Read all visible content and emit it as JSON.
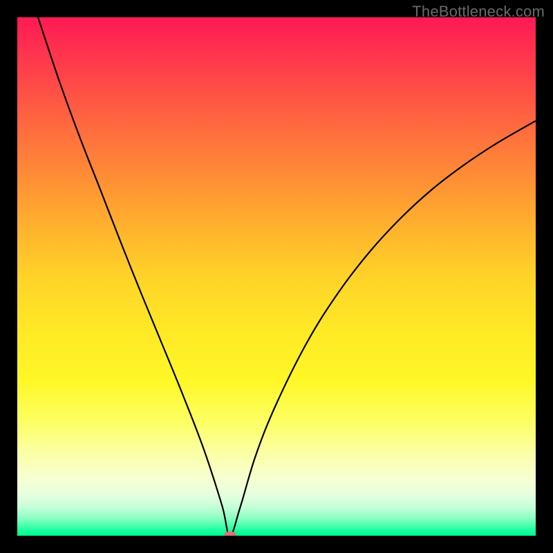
{
  "watermark": "TheBottleneck.com",
  "colors": {
    "frame": "#000000",
    "curve": "#000000",
    "marker": "#d8756f",
    "gradient_top": "#ff1a55",
    "gradient_bottom": "#00ff90"
  },
  "chart_data": {
    "type": "line",
    "title": "",
    "xlabel": "",
    "ylabel": "",
    "xlim": [
      0,
      100
    ],
    "ylim": [
      0,
      100
    ],
    "grid": false,
    "legend": false,
    "background": "rainbow-vertical-gradient",
    "curve_description": "V-shaped bottleneck curve: descends from top-left to a minimum near x≈41, then rises toward upper-right",
    "x": [
      4,
      8,
      12,
      16,
      20,
      24,
      28,
      32,
      36,
      39.5,
      41,
      43,
      46,
      50,
      56,
      62,
      68,
      74,
      80,
      86,
      92,
      98,
      100
    ],
    "y": [
      100,
      88,
      77,
      66.8,
      56.5,
      46.5,
      36.8,
      27,
      16.6,
      5.8,
      0,
      5.5,
      15.5,
      25.5,
      37.5,
      47,
      54.8,
      61.3,
      66.8,
      71.4,
      75.4,
      78.9,
      80
    ],
    "marker": {
      "x": 41,
      "y": 0,
      "w": 2.4,
      "h": 1.7
    }
  }
}
